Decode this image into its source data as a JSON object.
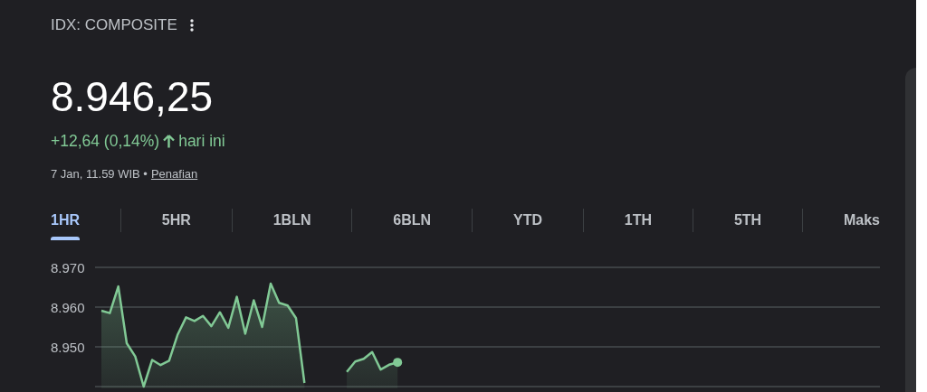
{
  "header": {
    "exchange": "IDX: COMPOSITE",
    "price": "8.946,25",
    "change": "+12,64 (0,14%)",
    "change_suffix": "hari ini",
    "timestamp": "7 Jan, 11.59 WIB •",
    "disclaimer_link": "Penafian"
  },
  "tabs": [
    {
      "label": "1HR",
      "selected": true
    },
    {
      "label": "5HR",
      "selected": false
    },
    {
      "label": "1BLN",
      "selected": false
    },
    {
      "label": "6BLN",
      "selected": false
    },
    {
      "label": "YTD",
      "selected": false
    },
    {
      "label": "1TH",
      "selected": false
    },
    {
      "label": "5TH",
      "selected": false
    },
    {
      "label": "Maks",
      "selected": false
    }
  ],
  "chart": {
    "chart_data": {
      "type": "area",
      "grid": true,
      "ylim": [
        8940,
        8970
      ],
      "yticks": [
        {
          "value": 8970,
          "label": "8.970"
        },
        {
          "value": 8960,
          "label": "8.960"
        },
        {
          "value": 8950,
          "label": "8.950"
        }
      ],
      "series": [
        {
          "color": "#81c995",
          "values": [
            8959.1,
            8958.5,
            8965.2,
            8950.9,
            8947.6,
            8940.0,
            8946.7,
            8945.4,
            8946.5,
            8953.0,
            8957.4,
            8956.5,
            8957.8,
            8955.2,
            8958.7,
            8954.8,
            8962.6,
            8953.3,
            8961.7,
            8955.0,
            8965.9,
            8961.1,
            8960.4,
            8957.2,
            8940.9,
            null,
            null,
            null,
            null,
            8943.7,
            8946.3,
            8947.0,
            8948.7,
            8944.3,
            8945.5,
            8946.1,
            null,
            null,
            null,
            null,
            null,
            null,
            null,
            null,
            null,
            null,
            null,
            null,
            null,
            null,
            null,
            null,
            null,
            null,
            null,
            null,
            null,
            null,
            null,
            null,
            null,
            null,
            null,
            null,
            null,
            null,
            null,
            null,
            null,
            null,
            null,
            null,
            null,
            null,
            null,
            null,
            null,
            null,
            null,
            null,
            null,
            null,
            null,
            null,
            null,
            null,
            null,
            null,
            null,
            null,
            null,
            null,
            null
          ]
        }
      ]
    }
  }
}
